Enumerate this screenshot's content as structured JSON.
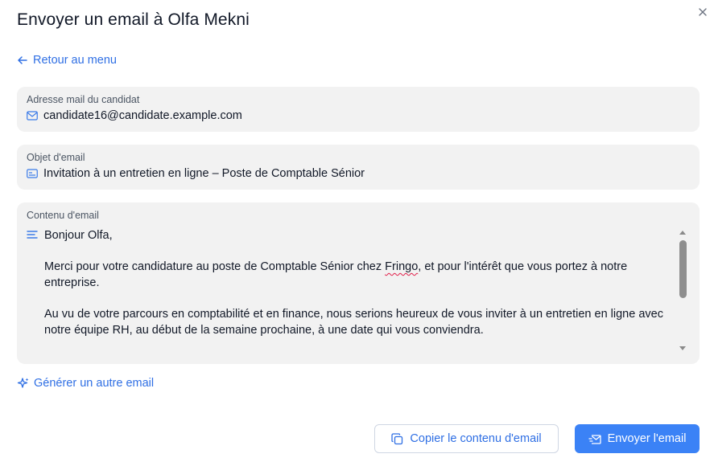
{
  "dialog": {
    "title": "Envoyer un email à Olfa Mekni",
    "close_icon": "close-icon"
  },
  "nav": {
    "back_label": "Retour au menu",
    "back_icon": "arrow-left-icon"
  },
  "email_field": {
    "label": "Adresse mail du candidat",
    "value": "candidate16@candidate.example.com",
    "icon": "envelope-icon"
  },
  "subject_field": {
    "label": "Objet d'email",
    "value": "Invitation à un entretien en ligne – Poste de Comptable Sénior",
    "icon": "card-icon"
  },
  "content_field": {
    "label": "Contenu d'email",
    "icon": "text-lines-icon",
    "greeting": "Bonjour Olfa,",
    "para1_before": "Merci pour votre candidature au poste de Comptable Sénior chez ",
    "para1_flagged": "Fringo",
    "para1_after": ", et pour l'intérêt que vous portez à notre entreprise.",
    "para2": "Au vu de votre parcours en comptabilité et en finance, nous serions heureux de vous inviter à un entretien en ligne avec notre équipe RH, au début de la semaine prochaine, à une date qui vous conviendra."
  },
  "actions": {
    "generate_label": "Générer un autre email",
    "generate_icon": "sparkles-icon",
    "copy_label": "Copier le contenu d'email",
    "copy_icon": "copy-icon",
    "send_label": "Envoyer l'email",
    "send_icon": "mail-send-icon"
  },
  "colors": {
    "accent": "#2f6fe4",
    "primary_button": "#3b82f6",
    "field_background": "#f2f2f2"
  }
}
